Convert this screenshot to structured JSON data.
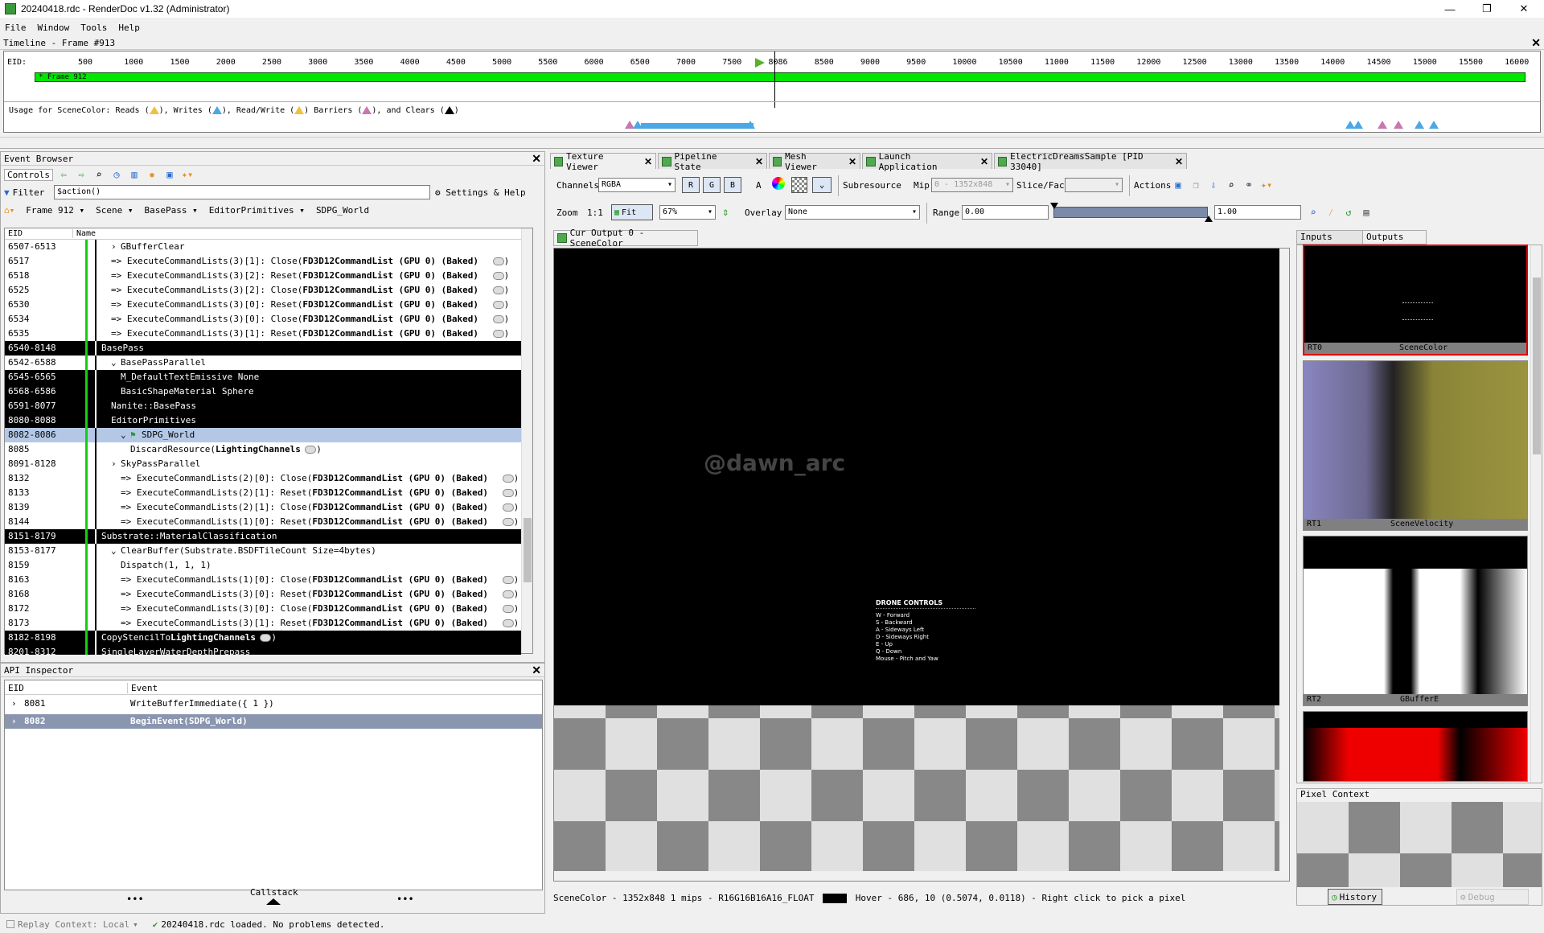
{
  "window": {
    "title": "20240418.rdc - RenderDoc v1.32 (Administrator)",
    "minimize": "—",
    "maximize": "❐",
    "close": "✕"
  },
  "menu": [
    "File",
    "Window",
    "Tools",
    "Help"
  ],
  "timeline": {
    "title": "Timeline - Frame #913",
    "eid_label": "EID:",
    "ticks": [
      "500",
      "1000",
      "1500",
      "2000",
      "2500",
      "3000",
      "3500",
      "4000",
      "4500",
      "5000",
      "5500",
      "6000",
      "6500",
      "7000",
      "7500",
      "8086",
      "8500",
      "9000",
      "9500",
      "10000",
      "10500",
      "11000",
      "11500",
      "12000",
      "12500",
      "13000",
      "13500",
      "14000",
      "14500",
      "15000",
      "15500",
      "16000"
    ],
    "frame_label": "* Frame 912",
    "usage_text": [
      "Usage for SceneColor: Reads (",
      "), Writes (",
      "), Read/Write (",
      ") Barriers (",
      "), and Clears (",
      ")"
    ],
    "colors": {
      "read": "#f0c040",
      "write": "#4aa8e6",
      "barrier": "#c877b0",
      "clear": "#000000",
      "frame": "#00e600"
    }
  },
  "event_browser": {
    "title": "Event Browser",
    "controls_label": "Controls",
    "filter_label": "Filter",
    "filter_value": "$action()",
    "settings_label": "Settings & Help",
    "breadcrumbs": [
      "Frame 912",
      "Scene",
      "BasePass",
      "EditorPrimitives",
      "SDPG_World"
    ],
    "columns": [
      "EID",
      "Name"
    ],
    "rows": [
      {
        "eid": "6507-6513",
        "name": "GBufferClear",
        "indent": 1,
        "style": "",
        "arrow": "›"
      },
      {
        "eid": "6517",
        "name": "=>  ExecuteCommandLists(3)[1]:  Close(FD3D12CommandList (GPU 0) (Baked)",
        "indent": 1,
        "style": "",
        "arrow": ""
      },
      {
        "eid": "6518",
        "name": "=>  ExecuteCommandLists(3)[2]:  Reset(FD3D12CommandList (GPU 0) (Baked)",
        "indent": 1,
        "style": "",
        "arrow": ""
      },
      {
        "eid": "6525",
        "name": "=>  ExecuteCommandLists(3)[2]:  Close(FD3D12CommandList (GPU 0) (Baked)",
        "indent": 1,
        "style": "",
        "arrow": ""
      },
      {
        "eid": "6530",
        "name": "=>  ExecuteCommandLists(3)[0]:  Reset(FD3D12CommandList (GPU 0) (Baked)",
        "indent": 1,
        "style": "",
        "arrow": ""
      },
      {
        "eid": "6534",
        "name": "=>  ExecuteCommandLists(3)[0]:  Close(FD3D12CommandList (GPU 0) (Baked)",
        "indent": 1,
        "style": "",
        "arrow": ""
      },
      {
        "eid": "6535",
        "name": "=>  ExecuteCommandLists(3)[1]:  Reset(FD3D12CommandList (GPU 0) (Baked)",
        "indent": 1,
        "style": "",
        "arrow": ""
      },
      {
        "eid": "6540-8148",
        "name": "BasePass",
        "indent": 0,
        "style": "dark",
        "arrow": ""
      },
      {
        "eid": "6542-6588",
        "name": "BasePassParallel",
        "indent": 1,
        "style": "",
        "arrow": "⌄"
      },
      {
        "eid": "6545-6565",
        "name": "M_DefaultTextEmissive None",
        "indent": 2,
        "style": "dark",
        "arrow": ""
      },
      {
        "eid": "6568-6586",
        "name": "BasicShapeMaterial Sphere",
        "indent": 2,
        "style": "dark",
        "arrow": ""
      },
      {
        "eid": "6591-8077",
        "name": "Nanite::BasePass",
        "indent": 1,
        "style": "dark",
        "arrow": ""
      },
      {
        "eid": "8080-8088",
        "name": "EditorPrimitives",
        "indent": 1,
        "style": "dark",
        "arrow": ""
      },
      {
        "eid": "8082-8086",
        "name": "SDPG_World",
        "indent": 2,
        "style": "sel",
        "arrow": "⌄"
      },
      {
        "eid": "8085",
        "name": "DiscardResource(LightingChannels",
        "indent": 3,
        "style": "",
        "arrow": ""
      },
      {
        "eid": "8091-8128",
        "name": "SkyPassParallel",
        "indent": 1,
        "style": "",
        "arrow": "›"
      },
      {
        "eid": "8132",
        "name": "=>  ExecuteCommandLists(2)[0]:  Close(FD3D12CommandList (GPU 0) (Baked)",
        "indent": 2,
        "style": "",
        "arrow": ""
      },
      {
        "eid": "8133",
        "name": "=>  ExecuteCommandLists(2)[1]:  Reset(FD3D12CommandList (GPU 0) (Baked)",
        "indent": 2,
        "style": "",
        "arrow": ""
      },
      {
        "eid": "8139",
        "name": "=>  ExecuteCommandLists(2)[1]:  Close(FD3D12CommandList (GPU 0) (Baked)",
        "indent": 2,
        "style": "",
        "arrow": ""
      },
      {
        "eid": "8144",
        "name": "=>  ExecuteCommandLists(1)[0]:  Reset(FD3D12CommandList (GPU 0) (Baked)",
        "indent": 2,
        "style": "",
        "arrow": ""
      },
      {
        "eid": "8151-8179",
        "name": "Substrate::MaterialClassification",
        "indent": 0,
        "style": "dark",
        "arrow": ""
      },
      {
        "eid": "8153-8177",
        "name": "ClearBuffer(Substrate.BSDFTileCount Size=4bytes)",
        "indent": 1,
        "style": "",
        "arrow": "⌄"
      },
      {
        "eid": "8159",
        "name": "Dispatch(1, 1, 1)",
        "indent": 2,
        "style": "",
        "arrow": ""
      },
      {
        "eid": "8163",
        "name": "=>  ExecuteCommandLists(1)[0]:  Close(FD3D12CommandList (GPU 0) (Baked)",
        "indent": 2,
        "style": "",
        "arrow": ""
      },
      {
        "eid": "8168",
        "name": "=>  ExecuteCommandLists(3)[0]:  Reset(FD3D12CommandList (GPU 0) (Baked)",
        "indent": 2,
        "style": "",
        "arrow": ""
      },
      {
        "eid": "8172",
        "name": "=>  ExecuteCommandLists(3)[0]:  Close(FD3D12CommandList (GPU 0) (Baked)",
        "indent": 2,
        "style": "",
        "arrow": ""
      },
      {
        "eid": "8173",
        "name": "=>  ExecuteCommandLists(3)[1]:  Reset(FD3D12CommandList (GPU 0) (Baked)",
        "indent": 2,
        "style": "",
        "arrow": ""
      },
      {
        "eid": "8182-8198",
        "name": "CopyStencilToLightingChannels",
        "indent": 0,
        "style": "dark",
        "arrow": ""
      },
      {
        "eid": "8201-8312",
        "name": "SingleLayerWaterDepthPrepass",
        "indent": 0,
        "style": "dark",
        "arrow": ""
      }
    ]
  },
  "api_inspector": {
    "title": "API Inspector",
    "columns": [
      "EID",
      "Event"
    ],
    "rows": [
      {
        "eid": "8081",
        "event": "WriteBufferImmediate({ 1 })",
        "selected": false
      },
      {
        "eid": "8082",
        "event": "BeginEvent(SDPG_World)",
        "selected": true
      }
    ],
    "callstack_label": "Callstack",
    "dots": "•••"
  },
  "tabs": [
    {
      "label": "Texture Viewer",
      "active": true
    },
    {
      "label": "Pipeline State",
      "active": false
    },
    {
      "label": "Mesh Viewer",
      "active": false
    },
    {
      "label": "Launch Application",
      "active": false
    },
    {
      "label": "ElectricDreamsSample [PID 33040]",
      "active": false
    }
  ],
  "texture_viewer": {
    "channels_label": "Channels",
    "channels_value": "RGBA",
    "chan_buttons": [
      "R",
      "G",
      "B",
      "A"
    ],
    "subresource_label": "Subresource",
    "mip_label": "Mip",
    "mip_value": "0 - 1352x848",
    "slice_label": "Slice/Face",
    "actions_label": "Actions",
    "zoom_label": "Zoom",
    "one_to_one": "1:1",
    "fit_label": "Fit",
    "zoom_value": "67%",
    "overlay_label": "Overlay",
    "overlay_value": "None",
    "range_label": "Range",
    "range_min": "0.00",
    "range_max": "1.00",
    "output_tab": "Cur Output 0 - SceneColor",
    "watermark": "@dawn_arc",
    "overlay_text": {
      "title": "DRONE CONTROLS",
      "lines": [
        "W - Forward",
        "S - Backward",
        "A - Sideways Left",
        "D - Sideways Right",
        "E - Up",
        "Q - Down",
        "Mouse - Pitch and Yaw"
      ]
    },
    "status": "SceneColor - 1352x848 1 mips - R16G16B16A16_FLOAT",
    "hover": "Hover -    686,    10 (0.5074, 0.0118)  - Right click to pick a pixel",
    "inputs_tab": "Inputs",
    "outputs_tab": "Outputs",
    "thumbnails": [
      {
        "slot": "RT0",
        "name": "SceneColor"
      },
      {
        "slot": "RT1",
        "name": "SceneVelocity"
      },
      {
        "slot": "RT2",
        "name": "GBufferE"
      },
      {
        "slot": "",
        "name": ""
      }
    ],
    "pixel_context": "Pixel Context",
    "history_label": "History",
    "debug_label": "Debug"
  },
  "statusbar": {
    "replay": "Replay Context: Local",
    "message": "20240418.rdc loaded. No problems detected."
  }
}
